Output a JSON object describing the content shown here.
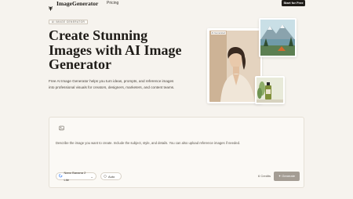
{
  "nav": {
    "brand": "ImageGenerator",
    "links": [
      "Pricing"
    ],
    "cta_label": "Start for Free",
    "logo_icon": "leaf-logo-icon"
  },
  "hero": {
    "eyebrow": "AI IMAGE GENERATOR",
    "headline": "Create Stunning Images with AI Image Generator",
    "subcopy": "Free AI Image Generator helps you turn ideas, prompts, and reference images into professional visuals for creators, designers, marketers, and content teams."
  },
  "showcase": {
    "main_tag": "AI Generated",
    "main_alt": "portrait",
    "lake_alt": "mountain lake",
    "bottle_alt": "product bottle"
  },
  "composer": {
    "upload_icon": "image-upload-icon",
    "prompt_placeholder": "Describe the image you want to create. Include the subject, style, and details. You can also upload reference images if needed.",
    "model_label": "Nano Banana 2 Lite",
    "model_icon": "google-g-icon",
    "ratio_label": "Auto",
    "ratio_icon": "ratio-circle-icon",
    "credits_text": "6 Credits",
    "generate_label": "Generate",
    "generate_icon": "sparkle-icon"
  },
  "colors": {
    "background": "#f6f3ee",
    "cta_bg": "#1f1c18",
    "generate_bg": "#a49d94"
  }
}
